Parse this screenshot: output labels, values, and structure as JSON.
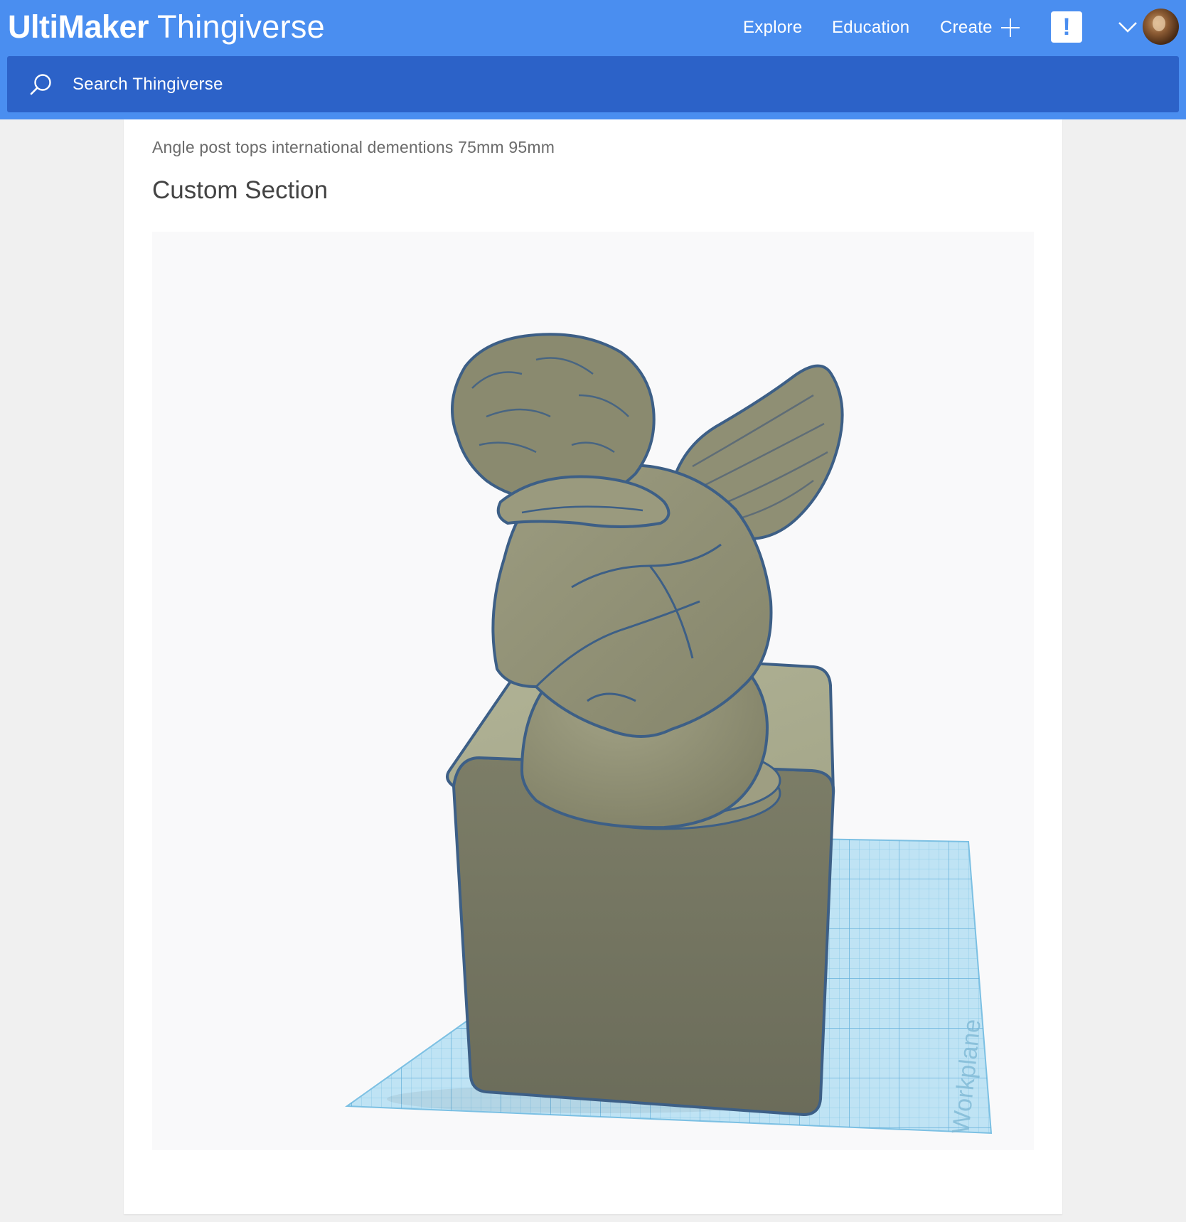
{
  "header": {
    "brand_bold": "UltiMaker",
    "brand_light": "Thingiverse",
    "nav": {
      "explore": "Explore",
      "education": "Education",
      "create": "Create"
    },
    "notification_mark": "!",
    "colors": {
      "header": "#4a8ef0",
      "search": "#2c62c8"
    }
  },
  "search": {
    "placeholder": "Search Thingiverse"
  },
  "content": {
    "description": "Angle post tops international dementions 75mm 95mm",
    "section_title": "Custom Section",
    "viewer": {
      "workplane_label": "Workplane",
      "model_color": "#9a9a7e",
      "outline_color": "#3d5f86",
      "grid_color": "#8ecbe8"
    }
  }
}
